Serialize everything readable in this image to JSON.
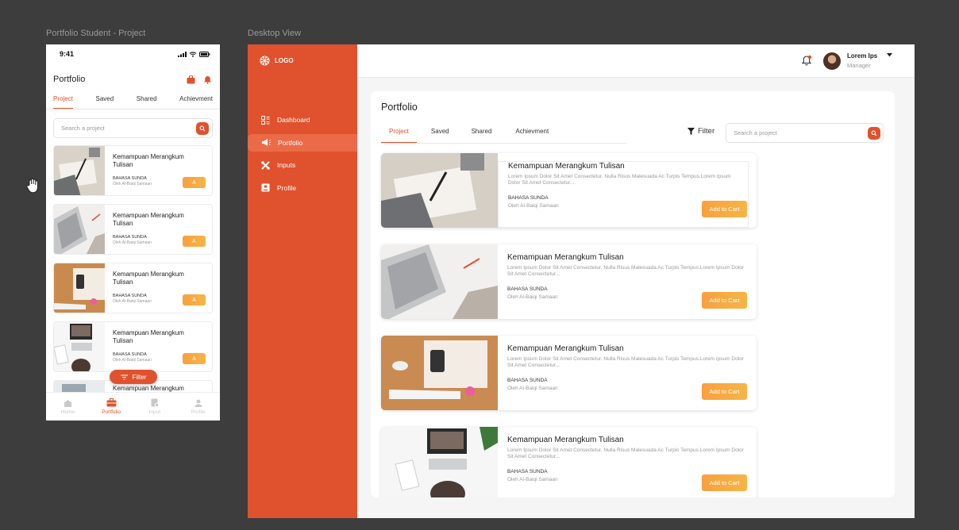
{
  "frames": {
    "mobile_label": "Portfolio Student - Project",
    "desktop_label": "Desktop View"
  },
  "mobile": {
    "status_time": "9:41",
    "title": "Portfolio",
    "tabs": [
      "Project",
      "Saved",
      "Shared",
      "Achievment"
    ],
    "search_placeholder": "Search a project",
    "cards": [
      {
        "title": "Kemampuan Merangkum Tulisan",
        "subject": "BAHASA SUNDA",
        "author": "Oleh Al-Baiqi Samaan",
        "button": "A"
      },
      {
        "title": "Kemampuan Merangkum Tulisan",
        "subject": "BAHASA SUNDA",
        "author": "Oleh Al-Baiqi Samaan",
        "button": "A"
      },
      {
        "title": "Kemampuan Merangkum Tulisan",
        "subject": "BAHASA SUNDA",
        "author": "Oleh Al-Baiqi Samaan",
        "button": "A"
      },
      {
        "title": "Kemampuan Merangkum Tulisan",
        "subject": "BAHASA SUNDA",
        "author": "Oleh Al-Baiqi Samaan",
        "button": "A"
      },
      {
        "title": "Kemampuan Merangkum",
        "subject": "",
        "author": "",
        "button": ""
      }
    ],
    "filter_label": "Filter",
    "nav": [
      "Home",
      "Portfolio",
      "Input",
      "Profile"
    ]
  },
  "desktop": {
    "logo": "LOGO",
    "nav": [
      "Dashboard",
      "Portfolio",
      "Inputs",
      "Profile"
    ],
    "user_name": "Lorem Ips",
    "user_role": "Manager",
    "panel_title": "Portfolio",
    "tabs": [
      "Project",
      "Saved",
      "Shared",
      "Achievment"
    ],
    "filter_label": "Filter",
    "search_placeholder": "Search a project",
    "cards": [
      {
        "title": "Kemampuan Merangkum Tulisan",
        "desc": "Lorem Ipsum Dolor Sit Amet Consectetur. Nulla Risus Malesuada Ac Turpis Tempus.Lorem Ipsum Dolor Sit Amet Consectetur...",
        "subject": "BAHASA SUNDA",
        "author": "Oleh Al-Baiqi Samaan",
        "button": "Add to Cart"
      },
      {
        "title": "Kemampuan Merangkum Tulisan",
        "desc": "Lorem Ipsum Dolor Sit Amet Consectetur. Nulla Risus Malesuada Ac Turpis Tempus.Lorem Ipsum Dolor Sit Amet Consectetur...",
        "subject": "BAHASA SUNDA",
        "author": "Oleh Al-Baiqi Samaan",
        "button": "Add to Cart"
      },
      {
        "title": "Kemampuan Merangkum Tulisan",
        "desc": "Lorem Ipsum Dolor Sit Amet Consectetur. Nulla Risus Malesuada Ac Turpis Tempus.Lorem Ipsum Dolor Sit Amet Consectetur...",
        "subject": "BAHASA SUNDA",
        "author": "Oleh Al-Baiqi Samaan",
        "button": "Add to Cart"
      },
      {
        "title": "Kemampuan Merangkum Tulisan",
        "desc": "Lorem Ipsum Dolor Sit Amet Consectetur. Nulla Risus Malesuada Ac Turpis Tempus.Lorem Ipsum Dolor Sit Amet Consectetur...",
        "subject": "BAHASA SUNDA",
        "author": "Oleh Al-Baiqi Samaan",
        "button": "Add to Cart"
      }
    ]
  },
  "colors": {
    "accent": "#e0522d",
    "cart": "#f9a03f",
    "canvas": "#3d3d3d"
  }
}
